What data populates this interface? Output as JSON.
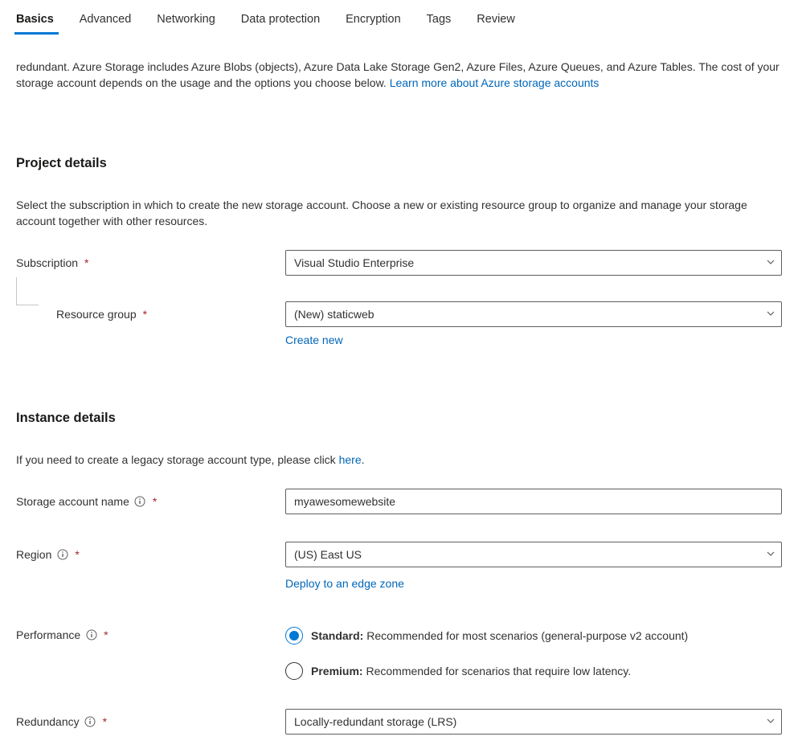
{
  "tabs": [
    {
      "label": "Basics",
      "active": true
    },
    {
      "label": "Advanced",
      "active": false
    },
    {
      "label": "Networking",
      "active": false
    },
    {
      "label": "Data protection",
      "active": false
    },
    {
      "label": "Encryption",
      "active": false
    },
    {
      "label": "Tags",
      "active": false
    },
    {
      "label": "Review",
      "active": false
    }
  ],
  "intro": {
    "text_part": "redundant. Azure Storage includes Azure Blobs (objects), Azure Data Lake Storage Gen2, Azure Files, Azure Queues, and Azure Tables. The cost of your storage account depends on the usage and the options you choose below. ",
    "link": "Learn more about Azure storage accounts"
  },
  "project_details": {
    "title": "Project details",
    "desc": "Select the subscription in which to create the new storage account. Choose a new or existing resource group to organize and manage your storage account together with other resources.",
    "subscription_label": "Subscription",
    "subscription_value": "Visual Studio Enterprise",
    "resource_group_label": "Resource group",
    "resource_group_value": "(New) staticweb",
    "create_new_link": "Create new"
  },
  "instance_details": {
    "title": "Instance details",
    "desc_part1": "If you need to create a legacy storage account type, please click ",
    "desc_link": "here",
    "desc_part2": ".",
    "storage_name_label": "Storage account name",
    "storage_name_value": "myawesomewebsite",
    "region_label": "Region",
    "region_value": "(US) East US",
    "deploy_edge_link": "Deploy to an edge zone",
    "performance_label": "Performance",
    "perf_standard_bold": "Standard:",
    "perf_standard_text": " Recommended for most scenarios (general-purpose v2 account)",
    "perf_premium_bold": "Premium:",
    "perf_premium_text": " Recommended for scenarios that require low latency.",
    "redundancy_label": "Redundancy",
    "redundancy_value": "Locally-redundant storage (LRS)"
  }
}
